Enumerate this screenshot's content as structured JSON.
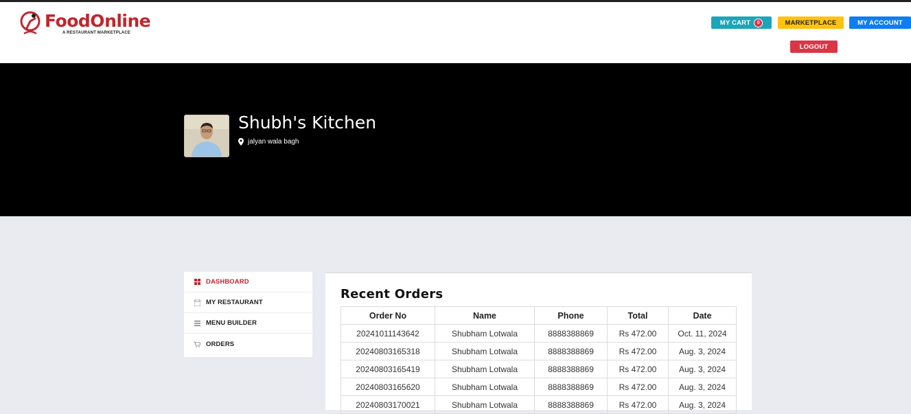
{
  "brand": {
    "name": "FoodOnline",
    "tagline": "A RESTAURANT MARKETPLACE",
    "primary_color": "#c0262d"
  },
  "header": {
    "cart_label": "MY CART",
    "cart_count": "0",
    "marketplace_label": "MARKETPLACE",
    "account_label": "MY ACCOUNT",
    "logout_label": "LOGOUT"
  },
  "profile": {
    "name": "Shubh's Kitchen",
    "location": "jalyan wala bagh",
    "location_icon": "map-pin-icon"
  },
  "sidebar": {
    "items": [
      {
        "label": "DASHBOARD",
        "icon": "dashboard-icon",
        "active": true
      },
      {
        "label": "MY RESTAURANT",
        "icon": "store-icon",
        "active": false
      },
      {
        "label": "MENU BUILDER",
        "icon": "menu-icon",
        "active": false
      },
      {
        "label": "ORDERS",
        "icon": "cart-icon",
        "active": false
      }
    ]
  },
  "orders": {
    "title": "Recent Orders",
    "columns": [
      "Order No",
      "Name",
      "Phone",
      "Total",
      "Date"
    ],
    "rows": [
      [
        "20241011143642",
        "Shubham Lotwala",
        "8888388869",
        "Rs 472.00",
        "Oct. 11, 2024"
      ],
      [
        "20240803165318",
        "Shubham Lotwala",
        "8888388869",
        "Rs 472.00",
        "Aug. 3, 2024"
      ],
      [
        "20240803165419",
        "Shubham Lotwala",
        "8888388869",
        "Rs 472.00",
        "Aug. 3, 2024"
      ],
      [
        "20240803165620",
        "Shubham Lotwala",
        "8888388869",
        "Rs 472.00",
        "Aug. 3, 2024"
      ],
      [
        "20240803170021",
        "Shubham Lotwala",
        "8888388869",
        "Rs 472.00",
        "Aug. 3, 2024"
      ]
    ]
  }
}
